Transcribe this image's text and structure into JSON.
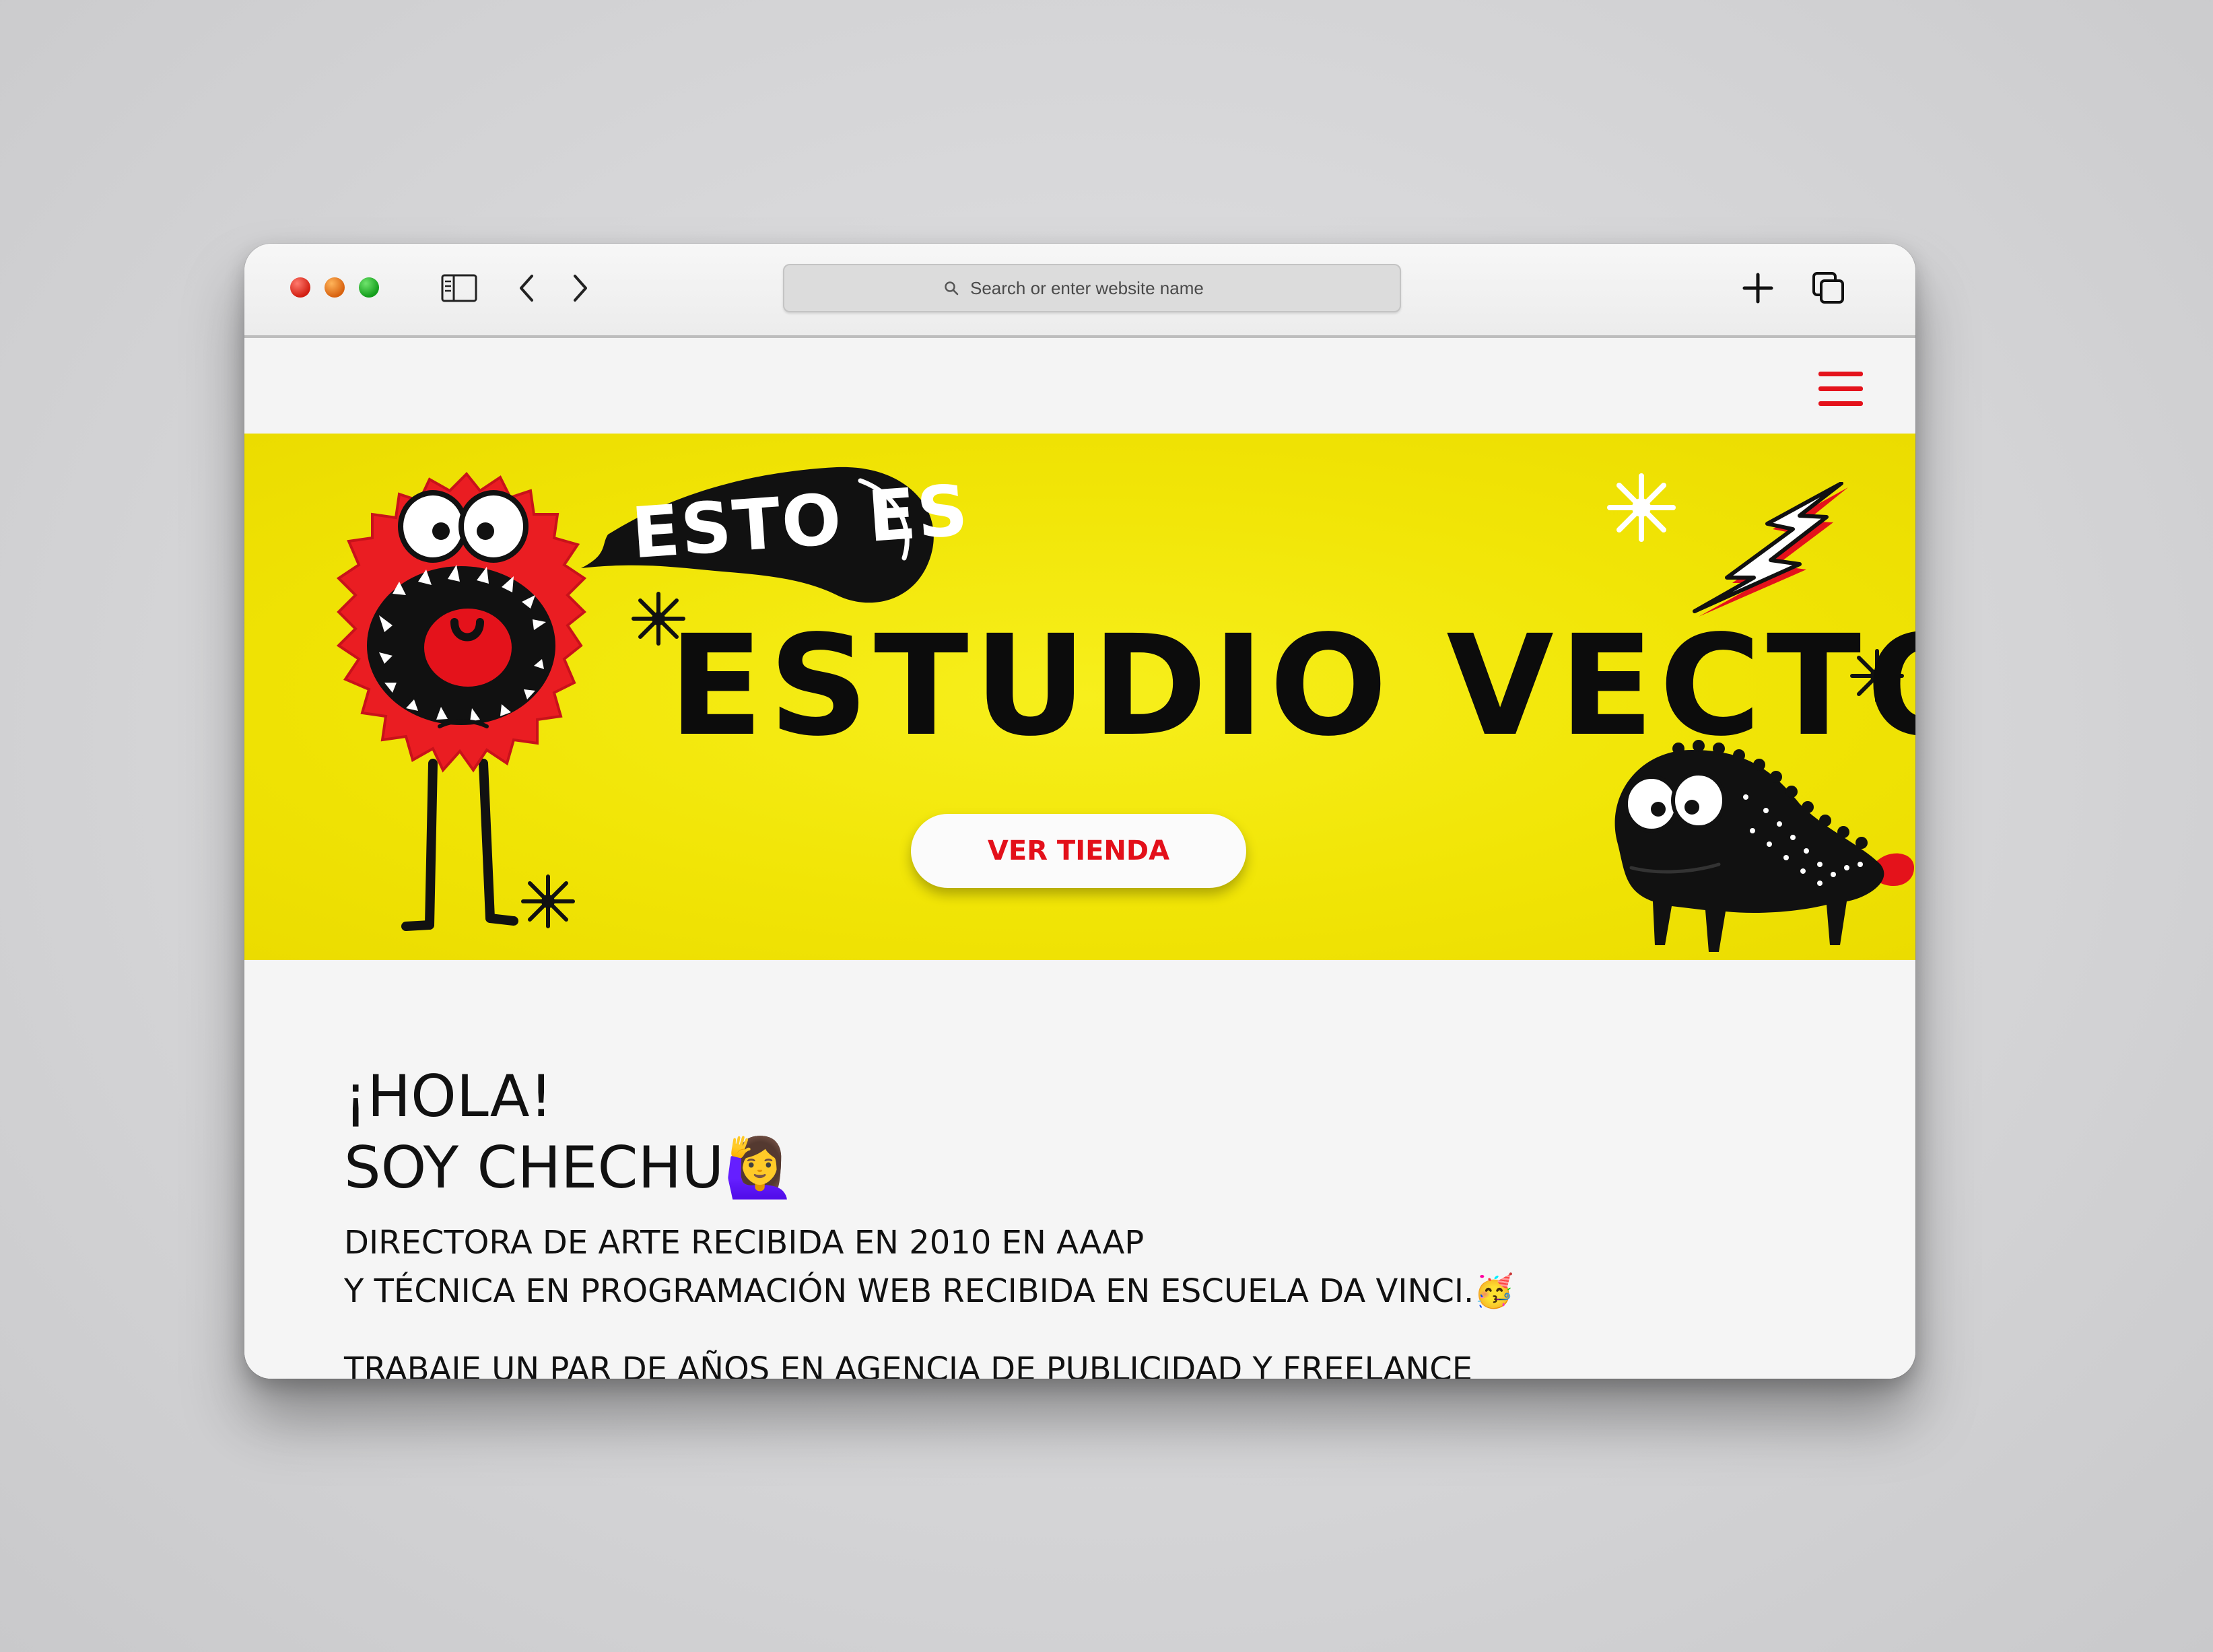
{
  "browser": {
    "search": {
      "placeholder": "Search or enter website name"
    }
  },
  "icons": {
    "sidebar": "sidebar-icon",
    "back": "chevron-left-icon",
    "forward": "chevron-right-icon",
    "new_tab": "plus-icon",
    "tabs": "tabs-overview-icon",
    "menu": "hamburger-menu-icon"
  },
  "hero": {
    "speech_text": "ESTO ES",
    "title": "ESTUDIO VECTOR!",
    "cta_label": "VER TIENDA"
  },
  "intro": {
    "greeting_line1": "¡HOLA!",
    "greeting_line2": "SOY CHECHU🙋‍♀️",
    "bio_line1": "DIRECTORA DE ARTE RECIBIDA EN 2010 EN AAAP",
    "bio_line2": "Y TÉCNICA EN PROGRAMACIÓN WEB RECIBIDA EN ESCUELA DA VINCI.🥳",
    "bio_line3": "TRABAJE UN PAR DE AÑOS EN AGENCIA DE PUBLICIDAD Y FREELANCE"
  },
  "colors": {
    "accent_red": "#e4121b",
    "hero_yellow": "#f1e506",
    "text_dark": "#111111"
  }
}
